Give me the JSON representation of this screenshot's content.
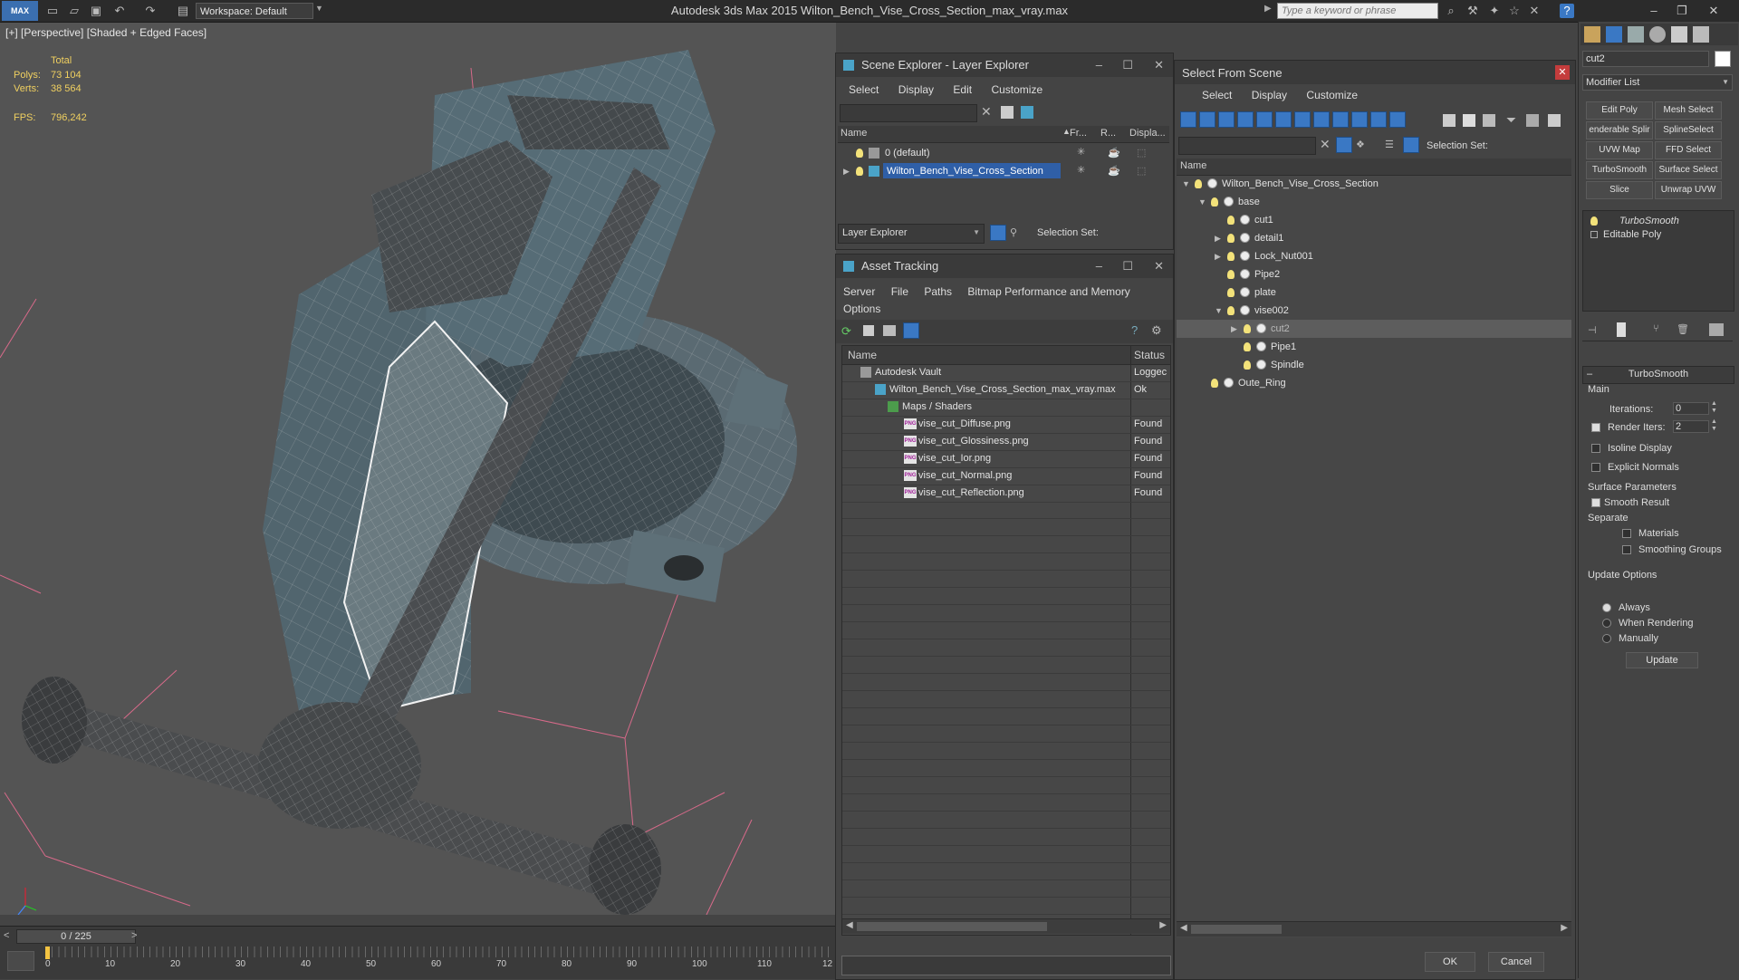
{
  "titlebar": {
    "logo": "MAX",
    "workspace": "Workspace: Default",
    "app_title": "Autodesk 3ds Max  2015     Wilton_Bench_Vise_Cross_Section_max_vray.max",
    "search_placeholder": "Type a keyword or phrase"
  },
  "viewport": {
    "label": "[+] [Perspective] [Shaded + Edged Faces]",
    "stats_total": "Total",
    "polys_label": "Polys:",
    "polys_value": "73 104",
    "verts_label": "Verts:",
    "verts_value": "38 564",
    "fps_label": "FPS:",
    "fps_value": "796,242"
  },
  "timeline": {
    "frame": "0 / 225",
    "prev": "<",
    "next": ">",
    "ticks": [
      "0",
      "10",
      "20",
      "30",
      "40",
      "50",
      "60",
      "70",
      "80",
      "90",
      "100",
      "110",
      "12"
    ]
  },
  "scene_explorer": {
    "title": "Scene Explorer - Layer Explorer",
    "menu": [
      "Select",
      "Display",
      "Edit",
      "Customize"
    ],
    "columns": [
      "Name",
      "Fr...",
      "R...",
      "Displa..."
    ],
    "rows": [
      "0 (default)",
      "Wilton_Bench_Vise_Cross_Section"
    ],
    "footer_mode": "Layer Explorer",
    "selection_set": "Selection Set:"
  },
  "asset_tracking": {
    "title": "Asset Tracking",
    "menu": [
      "Server",
      "File",
      "Paths",
      "Bitmap Performance and Memory",
      "Options"
    ],
    "col_name": "Name",
    "col_status": "Status",
    "rows": [
      {
        "name": "Autodesk Vault",
        "status": "Loggec"
      },
      {
        "name": "Wilton_Bench_Vise_Cross_Section_max_vray.max",
        "status": "Ok"
      },
      {
        "name": "Maps / Shaders",
        "status": ""
      },
      {
        "name": "vise_cut_Diffuse.png",
        "status": "Found"
      },
      {
        "name": "vise_cut_Glossiness.png",
        "status": "Found"
      },
      {
        "name": "vise_cut_Ior.png",
        "status": "Found"
      },
      {
        "name": "vise_cut_Normal.png",
        "status": "Found"
      },
      {
        "name": "vise_cut_Reflection.png",
        "status": "Found"
      }
    ],
    "png_tag": "PNG"
  },
  "select_from_scene": {
    "title": "Select From Scene",
    "menu": [
      "Select",
      "Display",
      "Customize"
    ],
    "selection_set": "Selection Set:",
    "col_name": "Name",
    "tree": [
      {
        "label": "Wilton_Bench_Vise_Cross_Section",
        "indent": 0,
        "arrow": "▼"
      },
      {
        "label": "base",
        "indent": 1,
        "arrow": "▼"
      },
      {
        "label": "cut1",
        "indent": 2,
        "arrow": ""
      },
      {
        "label": "detail1",
        "indent": 2,
        "arrow": "▶"
      },
      {
        "label": "Lock_Nut001",
        "indent": 2,
        "arrow": "▶"
      },
      {
        "label": "Pipe2",
        "indent": 2,
        "arrow": ""
      },
      {
        "label": "plate",
        "indent": 2,
        "arrow": ""
      },
      {
        "label": "vise002",
        "indent": 2,
        "arrow": "▼"
      },
      {
        "label": "cut2",
        "indent": 3,
        "arrow": "▶"
      },
      {
        "label": "Pipe1",
        "indent": 3,
        "arrow": ""
      },
      {
        "label": "Spindle",
        "indent": 3,
        "arrow": ""
      },
      {
        "label": "Oute_Ring",
        "indent": 1,
        "arrow": ""
      }
    ],
    "ok": "OK",
    "cancel": "Cancel"
  },
  "command_panel": {
    "object_name": "cut2",
    "modifier_list": "Modifier List",
    "buttons": [
      "Edit Poly",
      "Mesh Select",
      "enderable Splir",
      "SplineSelect",
      "UVW Map",
      "FFD Select",
      "TurboSmooth",
      "Surface Select",
      "Slice",
      "Unwrap UVW"
    ],
    "stack": [
      "TurboSmooth",
      "Editable Poly"
    ],
    "rollout_title": "TurboSmooth",
    "main": "Main",
    "iterations_label": "Iterations:",
    "iterations_value": "0",
    "render_iters_label": "Render Iters:",
    "render_iters_value": "2",
    "isoline": "Isoline Display",
    "explicit": "Explicit Normals",
    "surface_params": "Surface Parameters",
    "smooth_result": "Smooth Result",
    "separate": "Separate",
    "materials": "Materials",
    "smoothing_groups": "Smoothing Groups",
    "update_options": "Update Options",
    "always": "Always",
    "when_rendering": "When Rendering",
    "manually": "Manually",
    "update": "Update"
  }
}
